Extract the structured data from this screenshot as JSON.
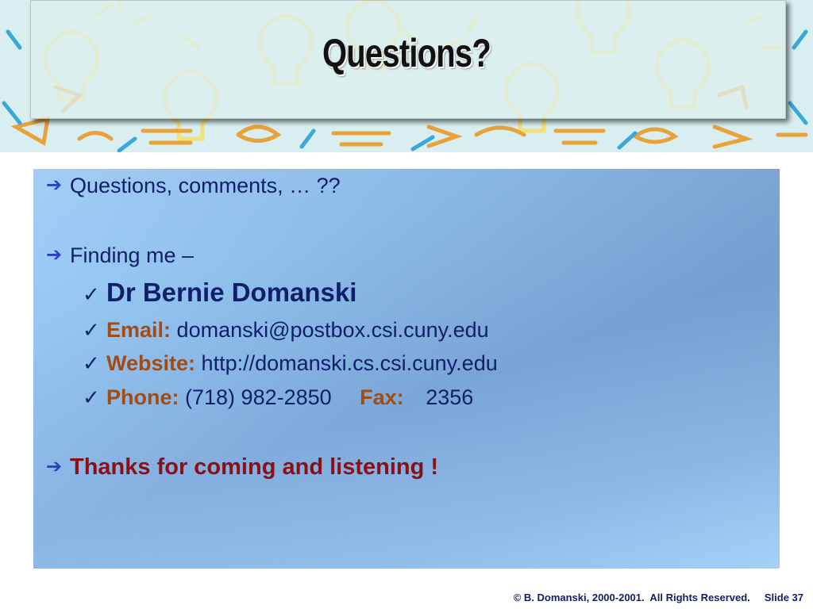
{
  "slide": {
    "title": "Questions?",
    "bullets": {
      "q": {
        "text": "Questions, comments, … ??"
      },
      "finding": {
        "text": "Finding me –"
      },
      "name": {
        "text": "Dr Bernie Domanski"
      },
      "email": {
        "label": "Email:",
        "value": "domanski@postbox.csi.cuny.edu"
      },
      "website": {
        "label": "Website:",
        "value": "http://domanski.cs.csi.cuny.edu"
      },
      "phone": {
        "label": "Phone:",
        "value": "(718) 982-2850",
        "fax_label": "Fax:",
        "fax_value": "2356"
      },
      "thanks": {
        "text": "Thanks for coming and listening !"
      }
    },
    "footer": {
      "copyright": "© B. Domanski, 2000-2001.  All Rights Reserved.",
      "slide_number": "Slide 37"
    }
  },
  "icons": {
    "bullet_arrow": "arrow-right-icon",
    "sub_bullet": "checkmark-icon",
    "background": "lightbulb-pattern"
  },
  "colors": {
    "title": "#111111",
    "text": "#0f1f6a",
    "label": "#a24b12",
    "thanks": "#8b0f14",
    "arrow": "#2a3fc4",
    "panel_light": "#a7d3fb",
    "panel_dark": "#7ba6d8"
  }
}
